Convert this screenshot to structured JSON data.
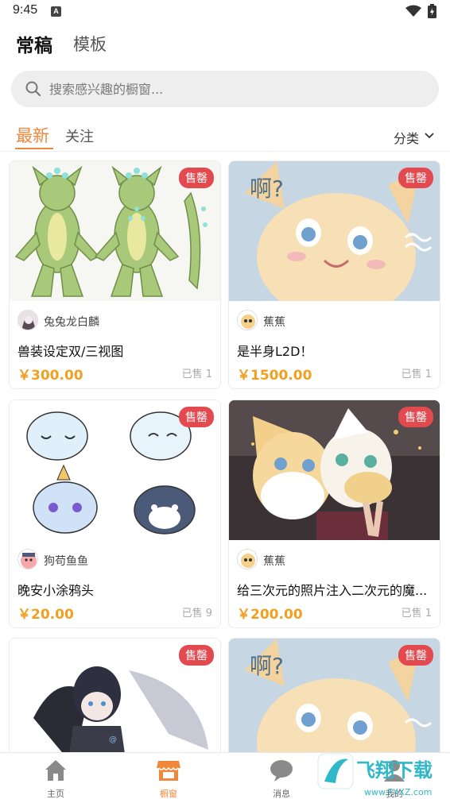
{
  "status": {
    "time": "9:45",
    "notif": "A"
  },
  "top_tabs": [
    {
      "label": "常稿"
    },
    {
      "label": "模板"
    }
  ],
  "search": {
    "placeholder": "搜索感兴趣的橱窗..."
  },
  "sub_tabs": [
    {
      "label": "最新"
    },
    {
      "label": "关注"
    }
  ],
  "category_label": "分类",
  "cards": [
    {
      "badge": "售罄",
      "author": "兔兔龙白麟",
      "title": "兽装设定双/三视图",
      "price": "￥300.00",
      "sold": "已售 1"
    },
    {
      "badge": "售罄",
      "author": "蕉蕉",
      "title": "是半身L2D！",
      "price": "￥1500.00",
      "sold": "已售 1"
    },
    {
      "badge": "售罄",
      "author": "狗苟鱼鱼",
      "title": "晚安小涂鸦头",
      "price": "￥20.00",
      "sold": "已售 9"
    },
    {
      "badge": "售罄",
      "author": "蕉蕉",
      "title": "给三次元的照片注入二次元的魔...",
      "price": "￥200.00",
      "sold": "已售 1"
    },
    {
      "badge": "售罄"
    },
    {
      "badge": "售罄"
    }
  ],
  "nav": [
    {
      "label": "主页",
      "icon": "home-icon"
    },
    {
      "label": "橱窗",
      "icon": "shop-icon"
    },
    {
      "label": "消息",
      "icon": "chat-icon"
    },
    {
      "label": "我的",
      "icon": "user-icon"
    }
  ],
  "colors": {
    "accent": "#f0873a",
    "price": "#f0a020",
    "badge": "#e24a4f"
  },
  "watermark": {
    "text": "飞翔下载",
    "sub": "www.FXXZ.com"
  }
}
